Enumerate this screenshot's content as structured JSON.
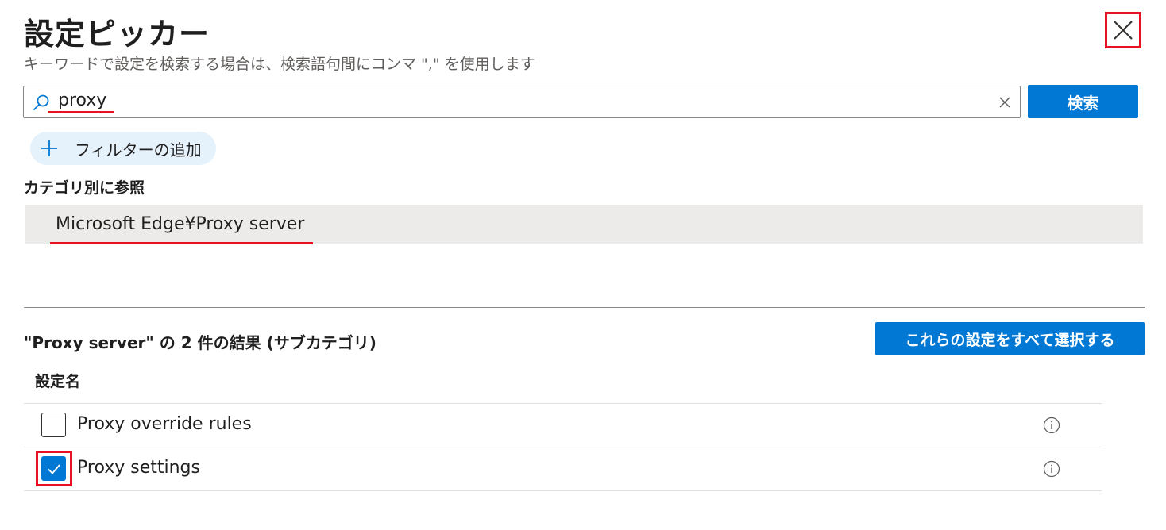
{
  "header": {
    "title": "設定ピッカー",
    "subtitle": "キーワードで設定を検索する場合は、検索語句間にコンマ \",\" を使用します"
  },
  "search": {
    "value": "proxy",
    "button_label": "検索"
  },
  "filter": {
    "add_label": "フィルターの追加"
  },
  "browse": {
    "section_label": "カテゴリ別に参照",
    "category": "Microsoft Edge¥Proxy server"
  },
  "results": {
    "summary": "\"Proxy server\" の 2 件の結果 (サブカテゴリ)",
    "select_all_label": "これらの設定をすべて選択する",
    "column_header": "設定名",
    "items": [
      {
        "name": "Proxy override rules",
        "checked": false
      },
      {
        "name": "Proxy settings",
        "checked": true
      }
    ]
  },
  "colors": {
    "accent": "#0078d4",
    "highlight": "#e81123",
    "category_bg": "#edebe9",
    "pill_bg": "#e5f1fb"
  },
  "icons": {
    "close": "close-icon",
    "search": "search-icon",
    "clear": "clear-icon",
    "add": "plus-icon",
    "info": "info-icon",
    "check": "checkmark-icon"
  }
}
